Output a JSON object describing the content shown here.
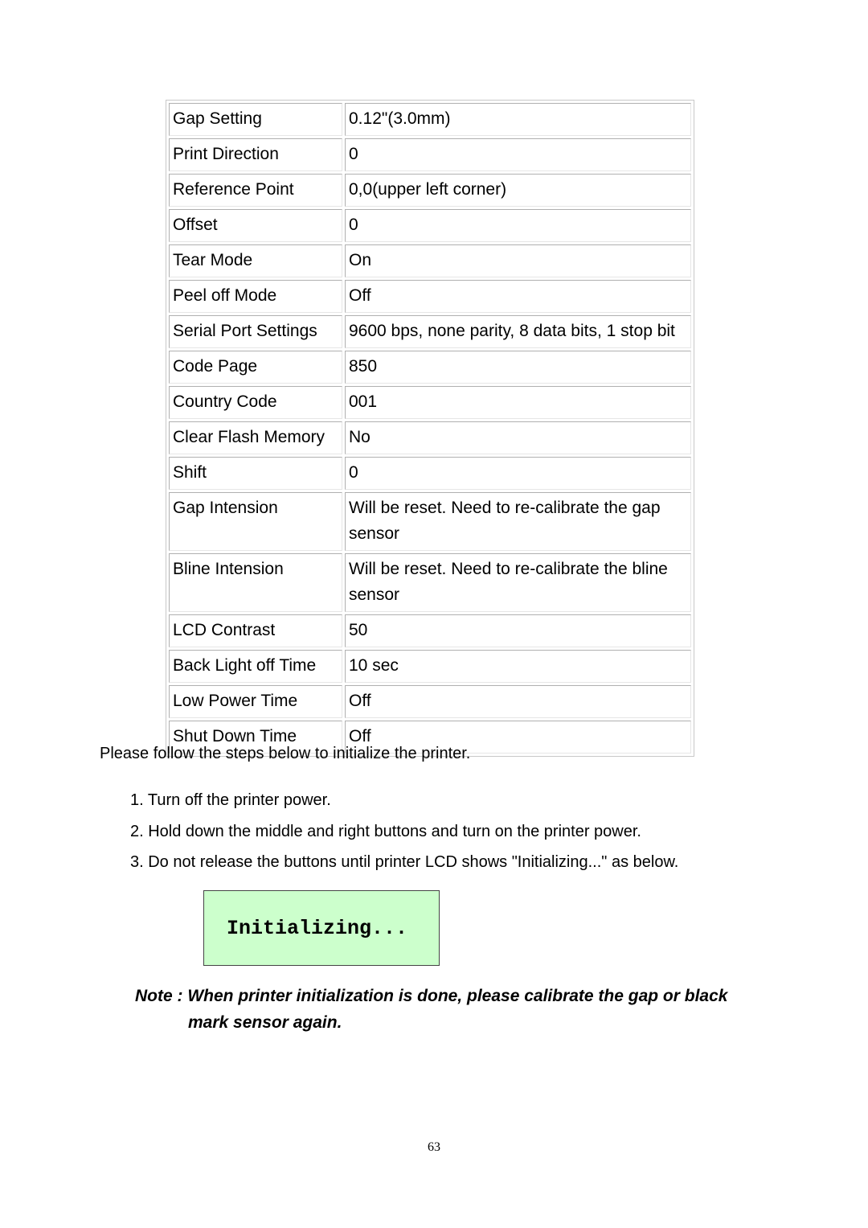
{
  "settings_table": [
    {
      "key": "Gap Setting",
      "value": "0.12\"(3.0mm)"
    },
    {
      "key": "Print Direction",
      "value": "0"
    },
    {
      "key": "Reference Point",
      "value": "0,0(upper left corner)"
    },
    {
      "key": "Offset",
      "value": "0"
    },
    {
      "key": "Tear Mode",
      "value": "On"
    },
    {
      "key": "Peel off Mode",
      "value": "Off"
    },
    {
      "key": "Serial Port Settings",
      "value": "9600 bps, none parity, 8 data bits, 1 stop bit"
    },
    {
      "key": "Code Page",
      "value": "850"
    },
    {
      "key": "Country Code",
      "value": "001"
    },
    {
      "key": "Clear Flash Memory",
      "value": "No"
    },
    {
      "key": "Shift",
      "value": "0"
    },
    {
      "key": "Gap Intension",
      "value": "Will be reset. Need to re-calibrate the gap sensor"
    },
    {
      "key": "Bline Intension",
      "value": "Will be reset. Need to re-calibrate the bline sensor"
    },
    {
      "key": "LCD Contrast",
      "value": "50"
    },
    {
      "key": "Back Light off Time",
      "value": "10 sec"
    },
    {
      "key": "Low Power Time",
      "value": "Off"
    },
    {
      "key": "Shut Down Time",
      "value": "Off"
    }
  ],
  "intro": "Please follow the steps below to initialize the printer.",
  "steps": [
    "1. Turn off the printer power.",
    "2. Hold down the middle  and right  buttons and turn on the printer power.",
    "3. Do not release the buttons until printer LCD shows \"Initializing...\" as below."
  ],
  "lcd_text": "Initializing...",
  "lcd_color": "#ccffcc",
  "note_line1": "Note : When printer initialization is done, please calibrate the gap or black",
  "note_line2": "mark sensor again.",
  "page_number": "63"
}
